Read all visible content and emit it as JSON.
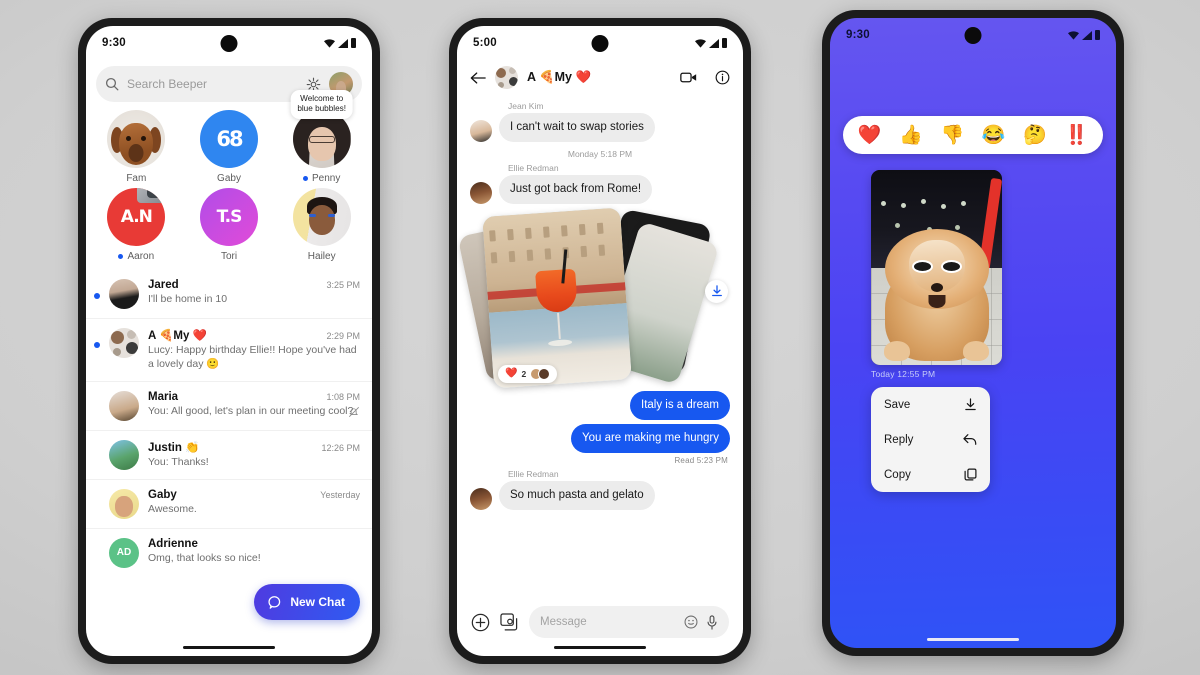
{
  "app": {
    "name": "Beeper",
    "accent": "#1758f0",
    "fab_gradient_from": "#4f3be0",
    "fab_gradient_to": "#2f5bf2"
  },
  "phone1": {
    "status": {
      "time": "9:30",
      "wifi": "wifi-icon",
      "signal": "signal-icon",
      "battery": "battery-icon"
    },
    "search": {
      "placeholder": "Search Beeper",
      "icon": "search-icon",
      "settings_icon": "gear-icon",
      "avatar": "profile-avatar"
    },
    "stories": [
      {
        "name": "Fam",
        "unread": false,
        "avatar": "dog-avatar"
      },
      {
        "name": "Gaby",
        "unread": false,
        "avatar": "beeper-logo-avatar",
        "logo_text": "68"
      },
      {
        "name": "Penny",
        "unread": true,
        "avatar": "penny-avatar",
        "tooltip_line1": "Welcome to",
        "tooltip_line2": "blue bubbles!"
      },
      {
        "name": "Aaron",
        "unread": true,
        "avatar": "aaron-avatar",
        "initials": "A.N"
      },
      {
        "name": "Tori",
        "unread": false,
        "avatar": "tori-avatar",
        "initials": "T.S"
      },
      {
        "name": "Hailey",
        "unread": false,
        "avatar": "hailey-avatar"
      }
    ],
    "chats": [
      {
        "name": "Jared",
        "preview": "I'll be home in 10",
        "time": "3:25 PM",
        "unread": true,
        "muted": false
      },
      {
        "name": "A 🍕My ❤️",
        "preview": "Lucy: Happy birthday Ellie!! Hope you've had a lovely day  🙂",
        "time": "2:29 PM",
        "unread": true,
        "muted": false
      },
      {
        "name": "Maria",
        "preview": "You: All good, let's plan in our meeting cool?",
        "time": "1:08 PM",
        "unread": false,
        "muted": true
      },
      {
        "name": "Justin 👏",
        "preview": "You: Thanks!",
        "time": "12:26 PM",
        "unread": false,
        "muted": false
      },
      {
        "name": "Gaby",
        "preview": "Awesome.",
        "time": "Yesterday",
        "unread": false,
        "muted": false
      },
      {
        "name": "Adrienne",
        "preview": "Omg, that looks so nice!",
        "time": "",
        "unread": false,
        "muted": false,
        "initials": "AD"
      }
    ],
    "fab": {
      "label": "New Chat",
      "icon": "chat-bubble-icon"
    }
  },
  "phone2": {
    "status": {
      "time": "5:00"
    },
    "header": {
      "back_icon": "back-arrow-icon",
      "title": "A 🍕My ❤️",
      "video_icon": "video-call-icon",
      "info_icon": "info-icon",
      "avatar": "group-avatar"
    },
    "messages": [
      {
        "type": "in",
        "sender": "Jean Kim",
        "text": "I can't wait to swap stories"
      },
      {
        "type": "day",
        "text": "Monday  5:18 PM"
      },
      {
        "type": "in",
        "sender": "Ellie Redman",
        "text": "Just got back from Rome!"
      },
      {
        "type": "photos",
        "reaction_emoji": "❤️",
        "reaction_count": "2",
        "download_icon": "download-icon"
      },
      {
        "type": "out",
        "text": "Italy is a dream"
      },
      {
        "type": "out",
        "text": "You are making me hungry"
      },
      {
        "type": "receipt",
        "text": "Read  5:23 PM"
      },
      {
        "type": "in",
        "sender": "Ellie Redman",
        "text": "So much pasta and gelato"
      }
    ],
    "composer": {
      "plus_icon": "plus-circle-icon",
      "gallery_icon": "gallery-icon",
      "placeholder": "Message",
      "emoji_icon": "emoji-icon",
      "mic_icon": "microphone-icon"
    }
  },
  "phone3": {
    "status": {
      "time": "9:30"
    },
    "reactions": [
      "❤️",
      "👍",
      "👎",
      "😂",
      "🤔",
      "‼️"
    ],
    "photo": {
      "alt": "dog-with-sunglasses-photo"
    },
    "timestamp": "Today  12:55 PM",
    "menu": [
      {
        "label": "Save",
        "icon": "download-icon"
      },
      {
        "label": "Reply",
        "icon": "reply-arrow-icon"
      },
      {
        "label": "Copy",
        "icon": "copy-icon"
      }
    ]
  }
}
